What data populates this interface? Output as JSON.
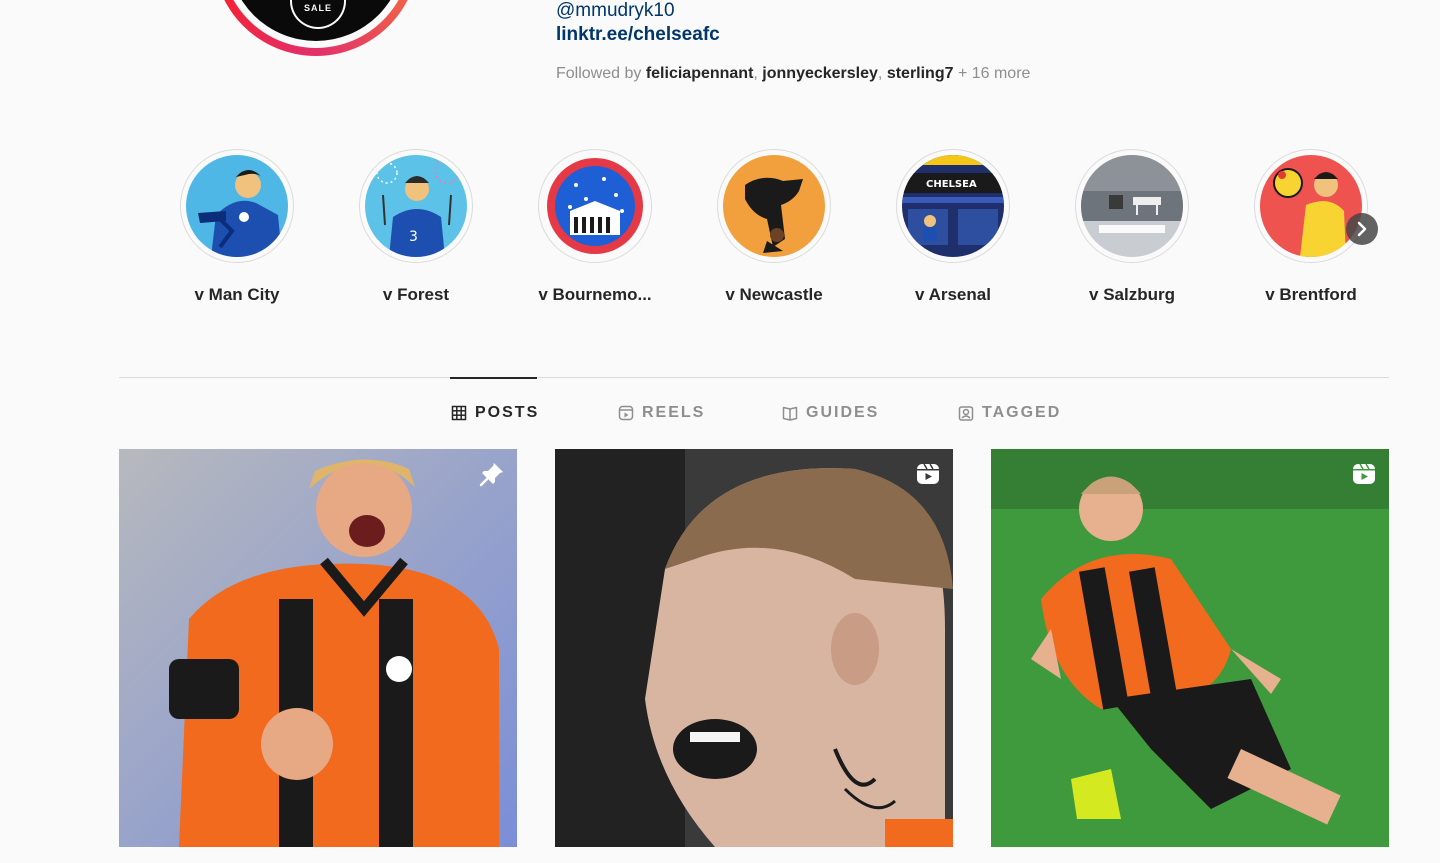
{
  "profile": {
    "handle": "@mmudryk10",
    "link": "linktr.ee/chelseafc",
    "followed_prefix": "Followed by ",
    "followers": [
      "feliciapennant",
      "jonnyeckersley",
      "sterling7"
    ],
    "followed_more": " + 16 more",
    "avatar_badge_text": "SALE"
  },
  "highlights": [
    {
      "label": "v Man City",
      "bg": "#4fb7e6"
    },
    {
      "label": "v Forest",
      "bg": "#5cc2e8"
    },
    {
      "label": "v Bournemo...",
      "bg": "#e63946"
    },
    {
      "label": "v Newcastle",
      "bg": "#f2a03d"
    },
    {
      "label": "v Arsenal",
      "bg": "#1f2f6b"
    },
    {
      "label": "v Salzburg",
      "bg": "#9aa0a6"
    },
    {
      "label": "v Brentford",
      "bg": "#ef5350"
    }
  ],
  "tabs": [
    {
      "label": "POSTS",
      "icon": "grid-icon",
      "active": true
    },
    {
      "label": "REELS",
      "icon": "reels-icon",
      "active": false
    },
    {
      "label": "GUIDES",
      "icon": "guides-icon",
      "active": false
    },
    {
      "label": "TAGGED",
      "icon": "tagged-icon",
      "active": false
    }
  ],
  "posts": [
    {
      "badge": "pin-icon"
    },
    {
      "badge": "reel-icon"
    },
    {
      "badge": "reel-icon"
    }
  ]
}
